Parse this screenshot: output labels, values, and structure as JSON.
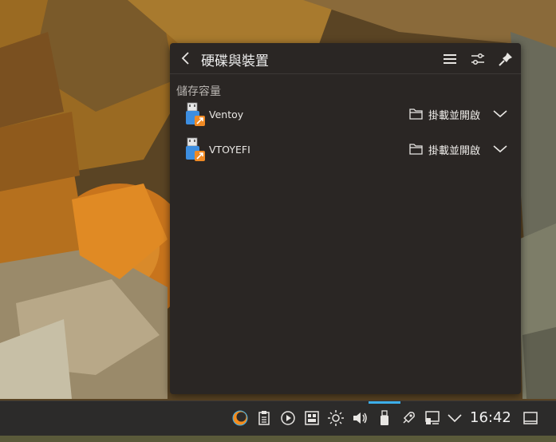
{
  "popup": {
    "title": "硬碟與裝置",
    "section_heading": "儲存容量",
    "devices": [
      {
        "name": "Ventoy",
        "action_label": "掛載並開啟"
      },
      {
        "name": "VTOYEFI",
        "action_label": "掛載並開啟"
      }
    ],
    "header_icons": [
      "back-icon",
      "menu-icon",
      "configure-icon",
      "pin-icon"
    ]
  },
  "taskbar": {
    "clock": "16:42",
    "active_indicator_color": "#3daee9",
    "tray_icons": [
      "plasma-logo-icon",
      "clipboard-icon",
      "media-player-icon",
      "keyboard-layout-icon",
      "brightness-icon",
      "volume-icon",
      "usb-drive-icon",
      "kde-connect-icon",
      "network-icon",
      "chevron-down-icon",
      "show-desktop-icon"
    ]
  },
  "colors": {
    "popup_bg": "#2a2624",
    "taskbar_bg": "#2c2b2a",
    "text": "#e8e6e3"
  }
}
